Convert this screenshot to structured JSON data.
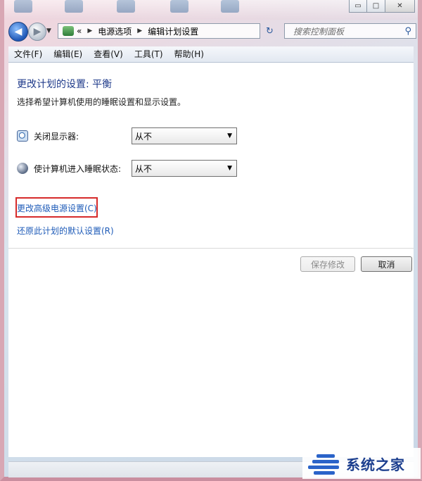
{
  "window": {
    "controls": {
      "minimize": "▭",
      "maximize": "□",
      "close": "✕"
    }
  },
  "address": {
    "breadcrumb": [
      "电源选项",
      "编辑计划设置"
    ],
    "overflow": "«",
    "search_placeholder": "搜索控制面板"
  },
  "menu": [
    "文件(F)",
    "编辑(E)",
    "查看(V)",
    "工具(T)",
    "帮助(H)"
  ],
  "content": {
    "title": "更改计划的设置: 平衡",
    "subtitle": "选择希望计算机使用的睡眠设置和显示设置。",
    "settings": [
      {
        "label": "关闭显示器:",
        "value": "从不",
        "icon": "monitor-icon"
      },
      {
        "label": "使计算机进入睡眠状态:",
        "value": "从不",
        "icon": "moon-icon"
      }
    ],
    "links": {
      "advanced": "更改高级电源设置(C)",
      "restore": "还原此计划的默认设置(R)"
    },
    "buttons": {
      "save": "保存修改",
      "cancel": "取消"
    }
  },
  "watermark": {
    "text": "系统之家"
  },
  "colors": {
    "link": "#1e5bb8",
    "title": "#1e3a8a",
    "highlight": "#d62b2b"
  }
}
